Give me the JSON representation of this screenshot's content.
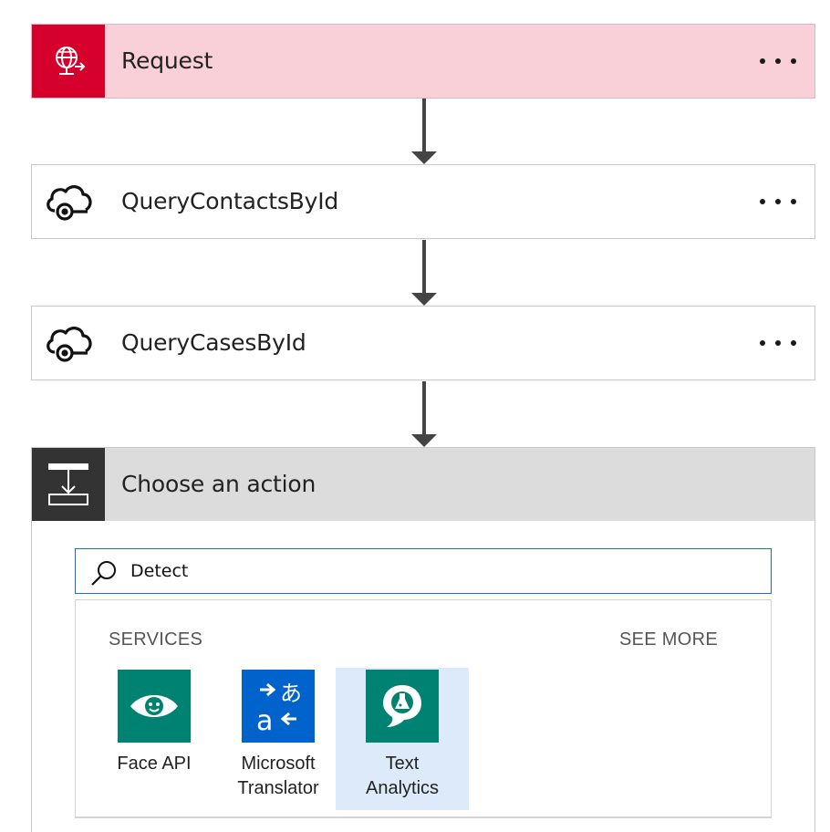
{
  "flow": {
    "steps": [
      {
        "title": "Request",
        "icon": "globe-request-icon",
        "color": "#d6002c",
        "background": "#f9d0d8"
      },
      {
        "title": "QueryContactsById",
        "icon": "cloud-connector-icon"
      },
      {
        "title": "QueryCasesById",
        "icon": "cloud-connector-icon"
      }
    ],
    "more_label": "•••"
  },
  "choose_action": {
    "title": "Choose an action",
    "icon": "action-choose-icon",
    "search": {
      "value": "Detect",
      "placeholder": ""
    },
    "services_label": "SERVICES",
    "see_more_label": "SEE MORE",
    "services": [
      {
        "label_line1": "Face API",
        "label_line2": "",
        "icon": "eye-face-icon",
        "color": "#008272"
      },
      {
        "label_line1": "Microsoft",
        "label_line2": "Translator",
        "icon": "translate-icon",
        "color": "#0063cc"
      },
      {
        "label_line1": "Text",
        "label_line2": "Analytics",
        "icon": "text-analytics-icon",
        "color": "#008272",
        "selected": true
      }
    ]
  }
}
